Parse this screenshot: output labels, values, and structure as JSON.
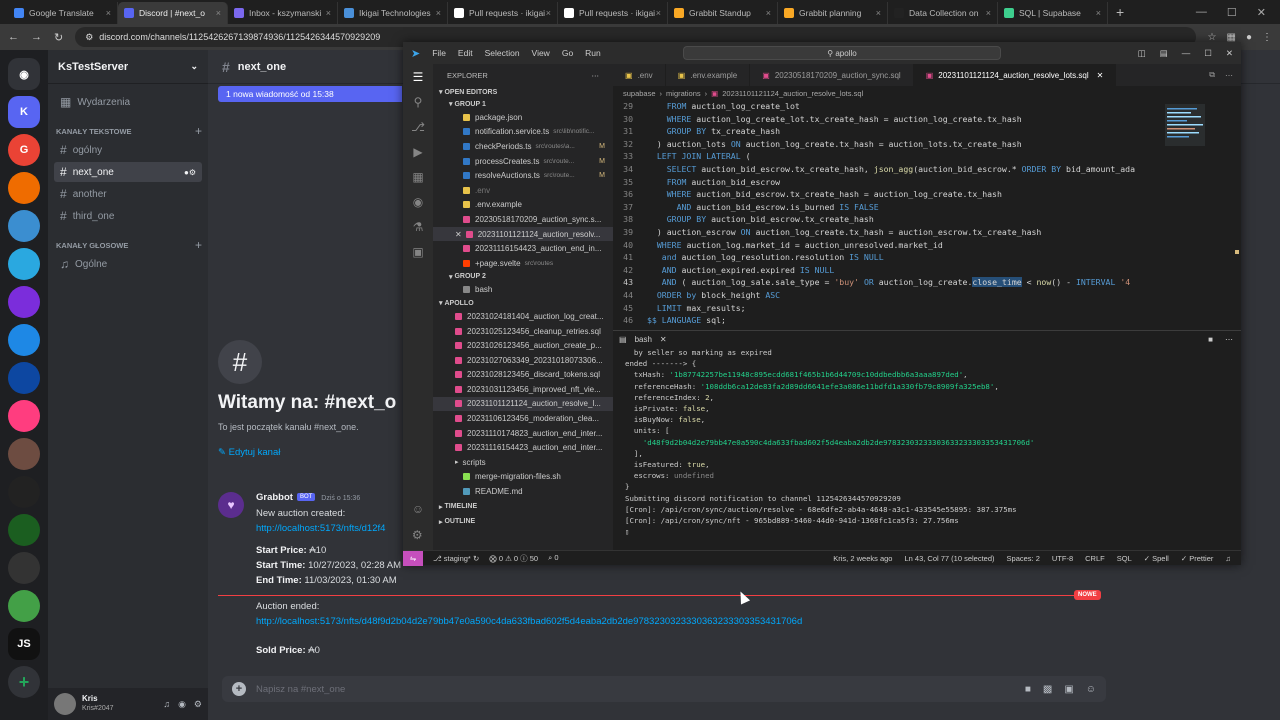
{
  "browser": {
    "tabs": [
      {
        "title": "Google Translate",
        "color": "#4285f4"
      },
      {
        "title": "Discord | #next_o",
        "color": "#5865f2"
      },
      {
        "title": "Inbox - kszymanski",
        "color": "#7b68ee"
      },
      {
        "title": "Ikigai Technologies",
        "color": "#4a90d9"
      },
      {
        "title": "Pull requests · ikigai",
        "color": "#ffffff"
      },
      {
        "title": "Pull requests · ikigai",
        "color": "#ffffff"
      },
      {
        "title": "Grabbit Standup",
        "color": "#f9a825"
      },
      {
        "title": "Grabbit planning",
        "color": "#f9a825"
      },
      {
        "title": "Data Collection on",
        "color": "#222222"
      },
      {
        "title": "SQL | Supabase",
        "color": "#3ecf8e"
      }
    ],
    "url": "discord.com/channels/1125426267139874936/1125426344570929209"
  },
  "discord": {
    "server_name": "KsTestServer",
    "text_category": "KANAŁY TEKSTOWE",
    "voice_category": "KANAŁY GŁOSOWE",
    "events_label": "Wydarzenia",
    "channels": [
      "ogólny",
      "next_one",
      "another",
      "third_one"
    ],
    "voice_channels": [
      "Ogólne"
    ],
    "current_channel": "next_one",
    "new_messages_banner": "1 nowa wiadomość od 15:38",
    "welcome_title": "Witamy na: #next_o",
    "welcome_sub": "To jest początek kanału #next_one.",
    "edit_channel": "Edytuj kanał",
    "servers": [
      "K",
      "G",
      "D",
      "JS"
    ],
    "message": {
      "author": "Grabbot",
      "bot_tag": "BOT",
      "time": "Dziś o 15:36",
      "line1": "New auction created:",
      "link1": "http://localhost:5173/nfts/d12f4",
      "start_price_label": "Start Price:",
      "start_price": "₳10",
      "start_time_label": "Start Time:",
      "start_time": "10/27/2023, 02:28 AM",
      "end_time_label": "End Time:",
      "end_time": "11/03/2023, 01:30 AM",
      "ended": "Auction ended:",
      "link2": "http://localhost:5173/nfts/d48f9d2b04d2e79bb47e0a590c4da633fbad602f5d4eaba2db2de9783230323330363233303353431706d",
      "sold_label": "Sold Price:",
      "sold_price": "₳0"
    },
    "new_badge": "NOWE",
    "input_placeholder": "Napisz na #next_one",
    "user": {
      "name": "Kris",
      "tag": "Kris#2047"
    }
  },
  "vscode": {
    "menu": [
      "File",
      "Edit",
      "Selection",
      "View",
      "Go",
      "Run"
    ],
    "search": "apollo",
    "explorer_title": "EXPLORER",
    "open_editors": "OPEN EDITORS",
    "group1": "GROUP 1",
    "group2": "GROUP 2",
    "apollo": "APOLLO",
    "group1_files": [
      {
        "name": "package.json",
        "dir": "",
        "m": "",
        "color": "#e8c34a"
      },
      {
        "name": "notification.service.ts",
        "dir": "src\\lib\\notific...",
        "m": "",
        "color": "#3178c6"
      },
      {
        "name": "checkPeriods.ts",
        "dir": "src\\routes\\a...",
        "m": "M",
        "color": "#3178c6"
      },
      {
        "name": "processCreates.ts",
        "dir": "src\\route...",
        "m": "M",
        "color": "#3178c6"
      },
      {
        "name": "resolveAuctions.ts",
        "dir": "src\\route...",
        "m": "M",
        "color": "#3178c6"
      },
      {
        "name": ".env",
        "dir": "",
        "m": "",
        "color": "#e8c34a"
      },
      {
        "name": ".env.example",
        "dir": "",
        "m": "",
        "color": "#e8c34a"
      },
      {
        "name": "20230518170209_auction_sync.s...",
        "dir": "",
        "m": "",
        "color": "#e04c8c"
      },
      {
        "name": "20231101121124_auction_resolv...",
        "dir": "",
        "m": "",
        "color": "#e04c8c"
      },
      {
        "name": "20231116154423_auction_end_in...",
        "dir": "",
        "m": "",
        "color": "#e04c8c"
      },
      {
        "name": "+page.svelte",
        "dir": "src\\routes",
        "m": "",
        "color": "#ff3e00"
      }
    ],
    "group2_files": [
      "bash"
    ],
    "apollo_files": [
      "20231024181404_auction_log_creat...",
      "20231025123456_cleanup_retries.sql",
      "20231026123456_auction_create_p...",
      "20231027063349_20231018073306...",
      "20231028123456_discard_tokens.sql",
      "20231031123456_improved_nft_vie...",
      "20231101121124_auction_resolve_l...",
      "20231106123456_moderation_clea...",
      "20231110174823_auction_end_inter...",
      "20231116154423_auction_end_inter..."
    ],
    "scripts_folder": "scripts",
    "script_files": [
      "merge-migration-files.sh",
      "README.md"
    ],
    "timeline": "TIMELINE",
    "outline": "OUTLINE",
    "editor_tabs": [
      ".env",
      ".env.example",
      "20230518170209_auction_sync.sql",
      "20231101121124_auction_resolve_lots.sql"
    ],
    "breadcrumb": [
      "supabase",
      "migrations",
      "20231101121124_auction_resolve_lots.sql"
    ],
    "code_start_line": 29,
    "cursor_line": 43,
    "terminal_label": "bash",
    "status": {
      "branch": "staging*",
      "errors": "0",
      "warnings": "0",
      "info": "50",
      "ports": "0",
      "blame": "Kris, 2 weeks ago",
      "position": "Ln 43, Col 77 (10 selected)",
      "spaces": "Spaces: 2",
      "encoding": "UTF-8",
      "eol": "CRLF",
      "lang": "SQL",
      "spell": "Spell",
      "prettier": "Prettier"
    }
  }
}
